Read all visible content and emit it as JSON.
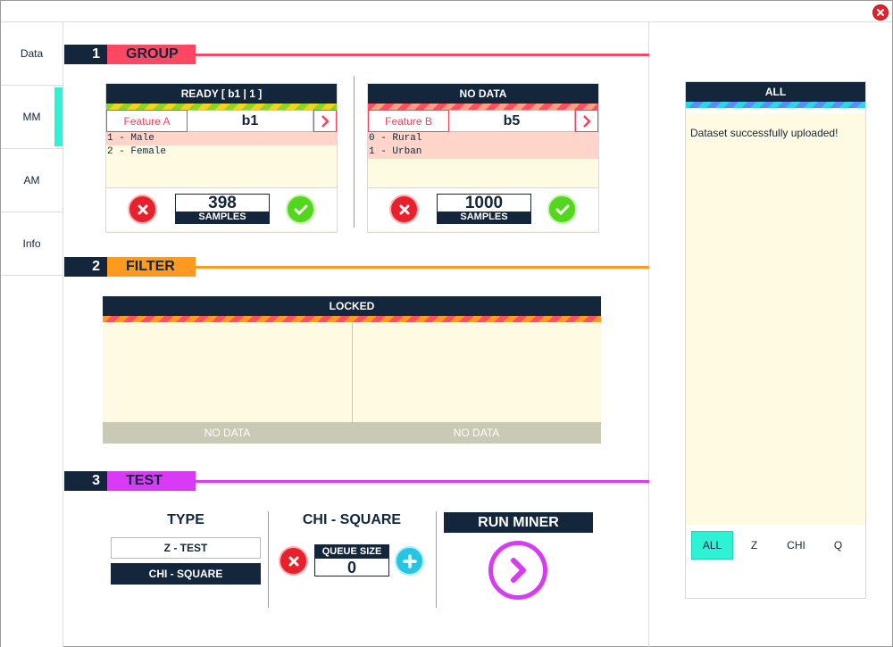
{
  "window": {
    "close_icon": "close-icon"
  },
  "sidebar": {
    "items": [
      {
        "label": "Data"
      },
      {
        "label": "MM"
      },
      {
        "label": "AM"
      },
      {
        "label": "Info"
      }
    ],
    "active_index": 1
  },
  "sections": {
    "group": {
      "number": "1",
      "title": "GROUP",
      "color": "#ff4763"
    },
    "filter": {
      "number": "2",
      "title": "FILTER",
      "color": "#ff9a20"
    },
    "test": {
      "number": "3",
      "title": "TEST",
      "color": "#d93af5"
    }
  },
  "group": {
    "panels": [
      {
        "status": "READY [ b1 | 1 ]",
        "feature_label": "Feature A",
        "feature_value": "b1",
        "categories": [
          "1 - Male",
          "2 - Female"
        ],
        "highlighted": [
          true,
          false
        ],
        "samples": "398",
        "samples_label": "SAMPLES"
      },
      {
        "status": "NO DATA",
        "feature_label": "Feature B",
        "feature_value": "b5",
        "categories": [
          "0 - Rural",
          "1 - Urban"
        ],
        "highlighted": [
          true,
          true
        ],
        "samples": "1000",
        "samples_label": "SAMPLES"
      }
    ]
  },
  "filter": {
    "status": "LOCKED",
    "footer": [
      "NO DATA",
      "NO DATA"
    ]
  },
  "test": {
    "type_title": "TYPE",
    "options": [
      "Z - TEST",
      "CHI - SQUARE"
    ],
    "selected_option": "CHI - SQUARE",
    "chosen_title": "CHI - SQUARE",
    "queue_label": "QUEUE SIZE",
    "queue_size": "0",
    "run_label": "RUN MINER"
  },
  "log": {
    "header": "ALL",
    "messages": [
      "Dataset successfully uploaded!"
    ],
    "tabs": [
      "ALL",
      "Z",
      "CHI",
      "Q"
    ],
    "active_tab": "ALL"
  },
  "colors": {
    "navy": "#13263b",
    "cyan_accent": "#2ef2d6",
    "panel_bg": "#fffbe3",
    "category_highlight": "#ffd5c9",
    "accept_green": "#52d61e",
    "reject_red": "#e8202c"
  }
}
